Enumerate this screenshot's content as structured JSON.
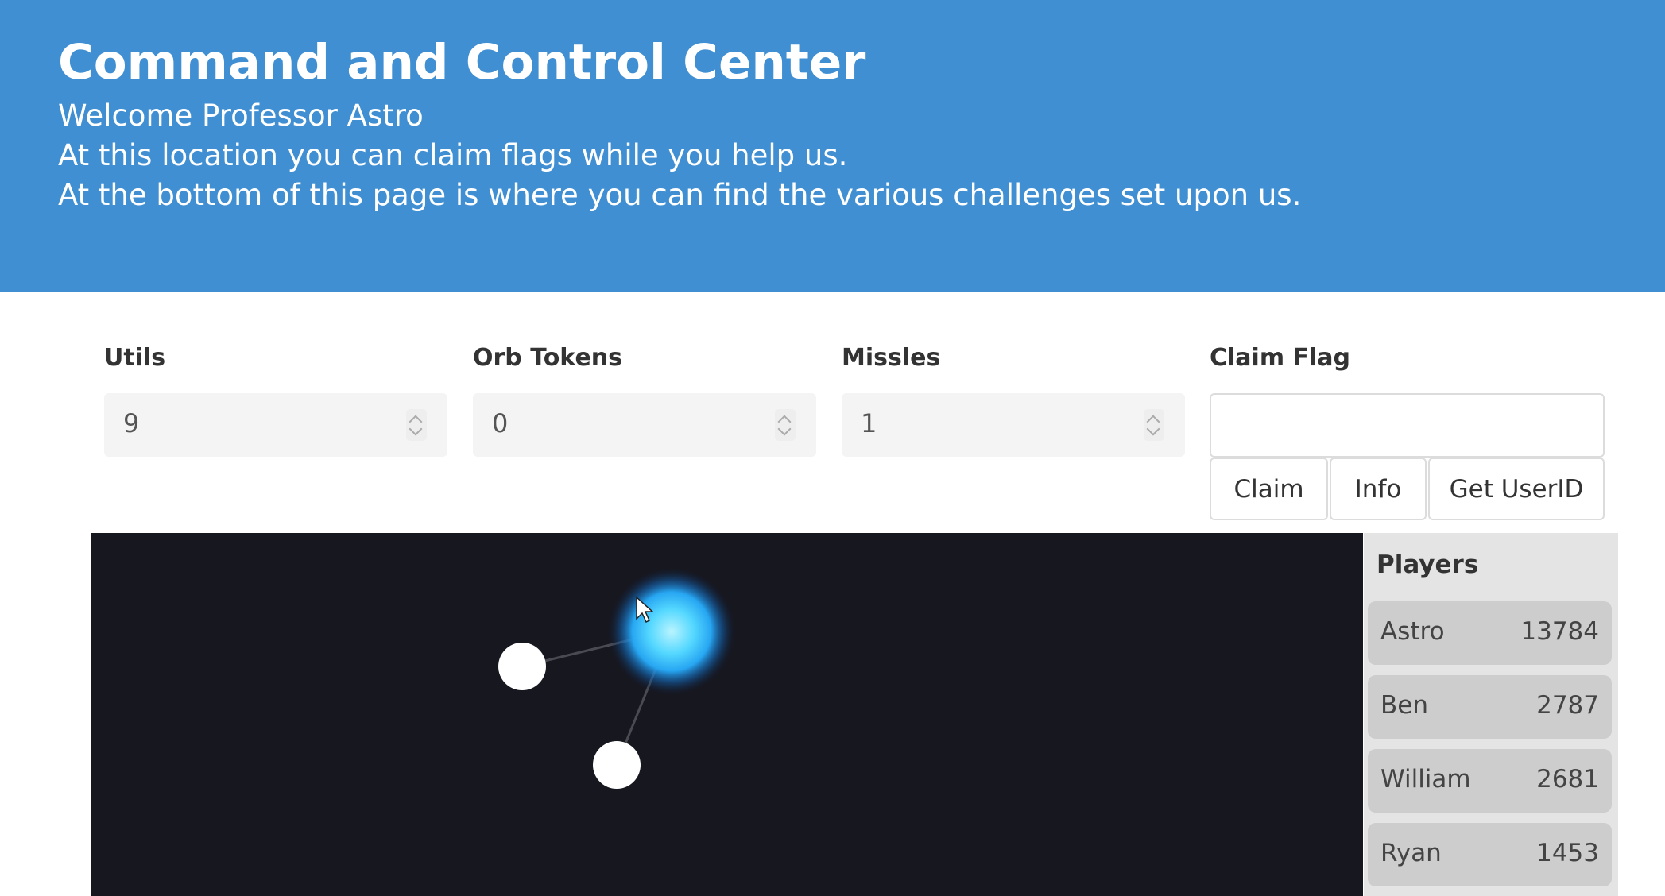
{
  "header": {
    "title": "Command and Control Center",
    "welcome": "Welcome Professor Astro",
    "line1": "At this location you can claim flags while you help us.",
    "line2": "At the bottom of this page is where you can find the various challenges set upon us."
  },
  "stats": {
    "utils": {
      "label": "Utils",
      "value": "9"
    },
    "orb_tokens": {
      "label": "Orb Tokens",
      "value": "0"
    },
    "missles": {
      "label": "Missles",
      "value": "1"
    }
  },
  "claim": {
    "label": "Claim Flag",
    "input_value": "",
    "claim_button": "Claim",
    "info_button": "Info",
    "userid_button": "Get UserID"
  },
  "players": {
    "title": "Players",
    "list": [
      {
        "name": "Astro",
        "score": "13784"
      },
      {
        "name": "Ben",
        "score": "2787"
      },
      {
        "name": "William",
        "score": "2681"
      },
      {
        "name": "Ryan",
        "score": "1453"
      }
    ]
  },
  "colors": {
    "header_bg": "#3f8fd2",
    "canvas_bg": "#171720",
    "orb_glow": "#3fc6ff"
  }
}
